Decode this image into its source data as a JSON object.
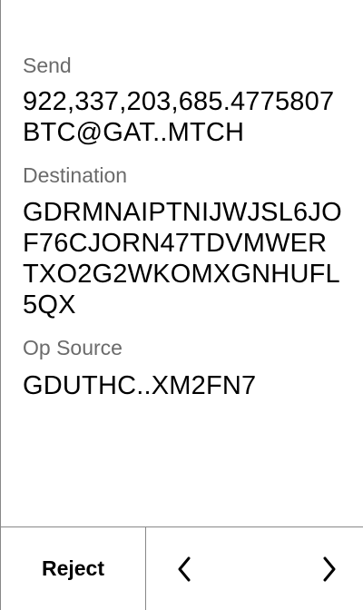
{
  "review": {
    "send": {
      "label": "Send",
      "value": "922,337,203,685.4775807 BTC@GAT..MTCH"
    },
    "destination": {
      "label": "Destination",
      "value": "GDRMNAIPTNIJWJSL6JOF76CJORN47TDVMWERTXO2G2WKOMXGNHUFL5QX"
    },
    "op_source": {
      "label": "Op Source",
      "value": "GDUTHC..XM2FN7"
    }
  },
  "footer": {
    "reject_label": "Reject",
    "prev_icon": "chevron-left-icon",
    "next_icon": "chevron-right-icon"
  }
}
